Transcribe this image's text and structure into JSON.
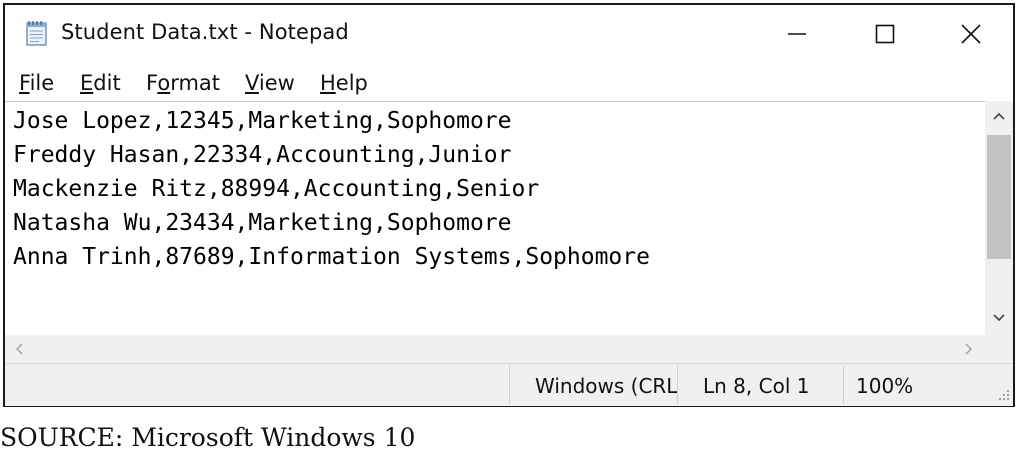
{
  "window": {
    "title": "Student Data.txt - Notepad",
    "icon": "notepad-icon"
  },
  "controls": {
    "minimize_icon": "minimize-icon",
    "maximize_icon": "maximize-icon",
    "close_icon": "close-icon"
  },
  "menu": {
    "items": [
      {
        "mnemonic": "F",
        "rest": "ile"
      },
      {
        "mnemonic": "E",
        "rest": "dit"
      },
      {
        "pre": "F",
        "mnemonic": "o",
        "rest": "rmat"
      },
      {
        "mnemonic": "V",
        "rest": "iew"
      },
      {
        "mnemonic": "H",
        "rest": "elp"
      }
    ]
  },
  "document": {
    "lines": [
      "Jose Lopez,12345,Marketing,Sophomore",
      "Freddy Hasan,22334,Accounting,Junior",
      "Mackenzie Ritz,88994,Accounting,Senior",
      "Natasha Wu,23434,Marketing,Sophomore",
      "Anna Trinh,87689,Information Systems,Sophomore"
    ]
  },
  "status": {
    "encoding": "Windows (CRL",
    "position": "Ln 8, Col 1",
    "zoom": "100%"
  },
  "caption": "SOURCE: Microsoft Windows 10",
  "colors": {
    "scrollbar_track": "#f0f0f0",
    "scrollbar_thumb": "#c2c2c2",
    "statusbar": "#f0f0f0"
  }
}
